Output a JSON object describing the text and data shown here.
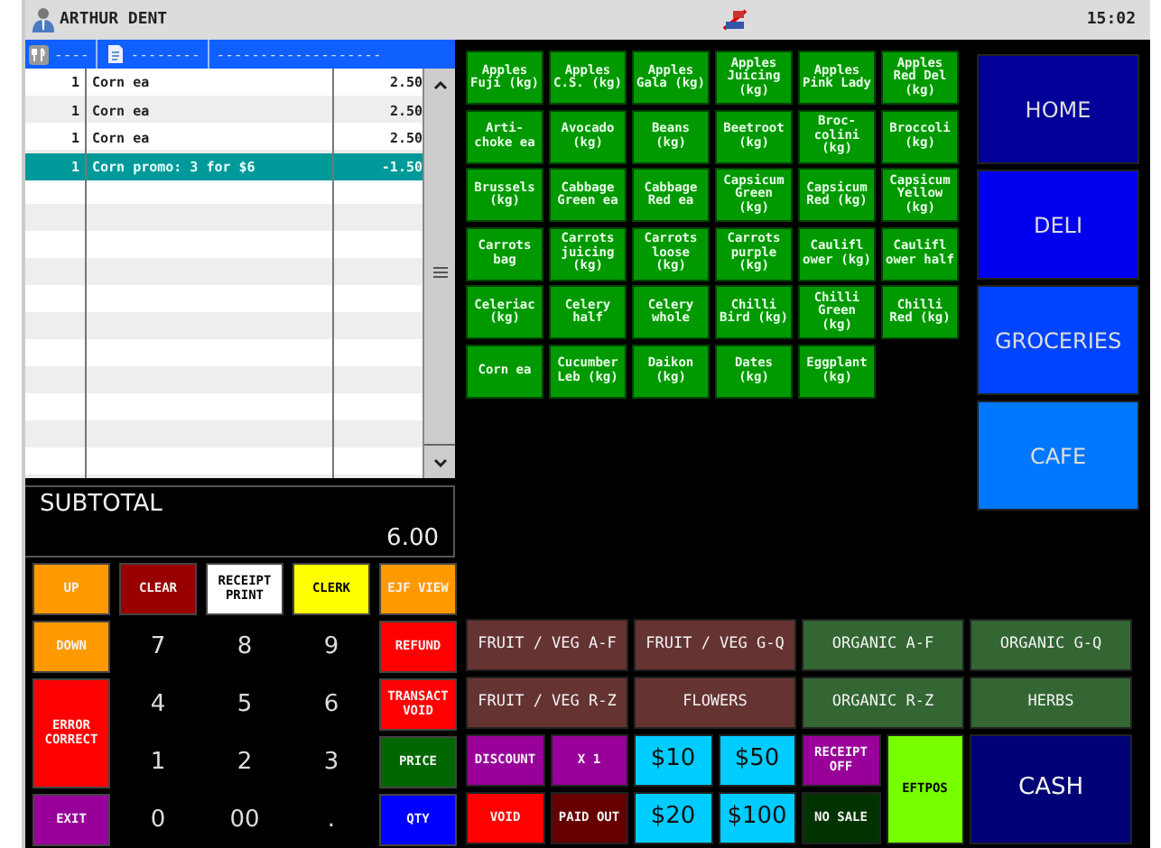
{
  "top_bar": {
    "user": "ARTHUR DENT",
    "time": "15:02"
  },
  "order_header": {
    "column_1": "----",
    "column_2": "--------",
    "column_3": "-------------------"
  },
  "order_lines": [
    {
      "qty": "1",
      "description": "Corn ea",
      "amount": "2.50",
      "selected": false
    },
    {
      "qty": "1",
      "description": "Corn ea",
      "amount": "2.50",
      "selected": false
    },
    {
      "qty": "1",
      "description": "Corn ea",
      "amount": "2.50",
      "selected": false
    },
    {
      "qty": "1",
      "description": "Corn promo: 3 for $6",
      "amount": "-1.50",
      "selected": true
    }
  ],
  "subtotal": {
    "label": "SUBTOTAL",
    "value": "6.00"
  },
  "keypad": [
    {
      "label": "UP",
      "kind": "function",
      "color": "#ff9900"
    },
    {
      "label": "CLEAR",
      "kind": "function",
      "color": "#990000"
    },
    {
      "label": "RECEIPT PRINT",
      "kind": "function",
      "color": "#ffffff"
    },
    {
      "label": "CLERK",
      "kind": "function",
      "color": "#ffff00"
    },
    {
      "label": "EJF VIEW",
      "kind": "function",
      "color": "#ff9900"
    },
    {
      "label": "DOWN",
      "kind": "function",
      "color": "#ff9900"
    },
    {
      "label": "7",
      "kind": "digit"
    },
    {
      "label": "8",
      "kind": "digit"
    },
    {
      "label": "9",
      "kind": "digit"
    },
    {
      "label": "REFUND",
      "kind": "function",
      "color": "#ff0000"
    },
    {
      "label": "ERROR CORRECT",
      "kind": "tall",
      "color": "#ff0000"
    },
    {
      "label": "4",
      "kind": "digit"
    },
    {
      "label": "5",
      "kind": "digit"
    },
    {
      "label": "6",
      "kind": "digit"
    },
    {
      "label": "TRANSACT VOID",
      "kind": "function",
      "color": "#ff0000"
    },
    {
      "label": "1",
      "kind": "digit"
    },
    {
      "label": "2",
      "kind": "digit"
    },
    {
      "label": "3",
      "kind": "digit"
    },
    {
      "label": "PRICE",
      "kind": "function",
      "color": "#006600"
    },
    {
      "label": "EXIT",
      "kind": "function",
      "color": "#990099"
    },
    {
      "label": "0",
      "kind": "digit"
    },
    {
      "label": "00",
      "kind": "digit"
    },
    {
      "label": ".",
      "kind": "digit"
    },
    {
      "label": "QTY",
      "kind": "function",
      "color": "#0000ff"
    }
  ],
  "products": [
    "Apples Fuji (kg)",
    "Apples C.S. (kg)",
    "Apples Gala (kg)",
    "Apples Juicing (kg)",
    "Apples Pink Lady",
    "Apples Red Del (kg)",
    "Arti- choke ea",
    "Avocado (kg)",
    "Beans (kg)",
    "Beetroot (kg)",
    "Broc- colini (kg)",
    "Broccoli (kg)",
    "Brussels (kg)",
    "Cabbage Green ea",
    "Cabbage Red ea",
    "Capsicum Green (kg)",
    "Capsicum Red (kg)",
    "Capsicum Yellow (kg)",
    "Carrots bag",
    "Carrots juicing (kg)",
    "Carrots loose (kg)",
    "Carrots purple (kg)",
    "Caulifl ower (kg)",
    "Caulifl ower half",
    "Celeriac (kg)",
    "Celery half",
    "Celery whole",
    "Chilli Bird (kg)",
    "Chilli Green (kg)",
    "Chilli Red (kg)",
    "Corn ea",
    "Cucumber Leb (kg)",
    "Daikon (kg)",
    "Dates (kg)",
    "Eggplant (kg)"
  ],
  "departments": [
    {
      "label": "HOME",
      "color": "#000099"
    },
    {
      "label": "DELI",
      "color": "#0000ee"
    },
    {
      "label": "GROCERIES",
      "color": "#0044ff"
    },
    {
      "label": "CAFE",
      "color": "#0077ff"
    }
  ],
  "bottom_buttons": [
    {
      "label": "FRUIT / VEG A-F",
      "kind": "category",
      "color": "#663333"
    },
    {
      "label": "FRUIT / VEG G-Q",
      "kind": "category",
      "color": "#663333"
    },
    {
      "label": "ORGANIC A-F",
      "kind": "category",
      "color": "#336633"
    },
    {
      "label": "ORGANIC G-Q",
      "kind": "category",
      "color": "#336633"
    },
    {
      "label": "FRUIT / VEG R-Z",
      "kind": "category",
      "color": "#663333"
    },
    {
      "label": "FLOWERS",
      "kind": "category",
      "color": "#663333"
    },
    {
      "label": "ORGANIC R-Z",
      "kind": "category",
      "color": "#336633"
    },
    {
      "label": "HERBS",
      "kind": "category",
      "color": "#336633"
    },
    {
      "label": "DISCOUNT",
      "kind": "small",
      "color": "#990099"
    },
    {
      "label": "X 1",
      "kind": "small",
      "color": "#990099"
    },
    {
      "label": "$10",
      "kind": "money",
      "color": "#00ccff"
    },
    {
      "label": "$50",
      "kind": "money",
      "color": "#00ccff"
    },
    {
      "label": "RECEIPT OFF",
      "kind": "small",
      "color": "#990099"
    },
    {
      "label": "EFTPOS",
      "kind": "tall",
      "color": "#77ff00"
    },
    {
      "label": "CASH",
      "kind": "big",
      "color": "#000077"
    },
    {
      "label": "VOID",
      "kind": "small",
      "color": "#ff0000"
    },
    {
      "label": "PAID OUT",
      "kind": "small",
      "color": "#660000"
    },
    {
      "label": "$20",
      "kind": "money",
      "color": "#00ccff"
    },
    {
      "label": "$100",
      "kind": "money",
      "color": "#00ccff"
    },
    {
      "label": "NO SALE",
      "kind": "small",
      "color": "#003300"
    }
  ]
}
